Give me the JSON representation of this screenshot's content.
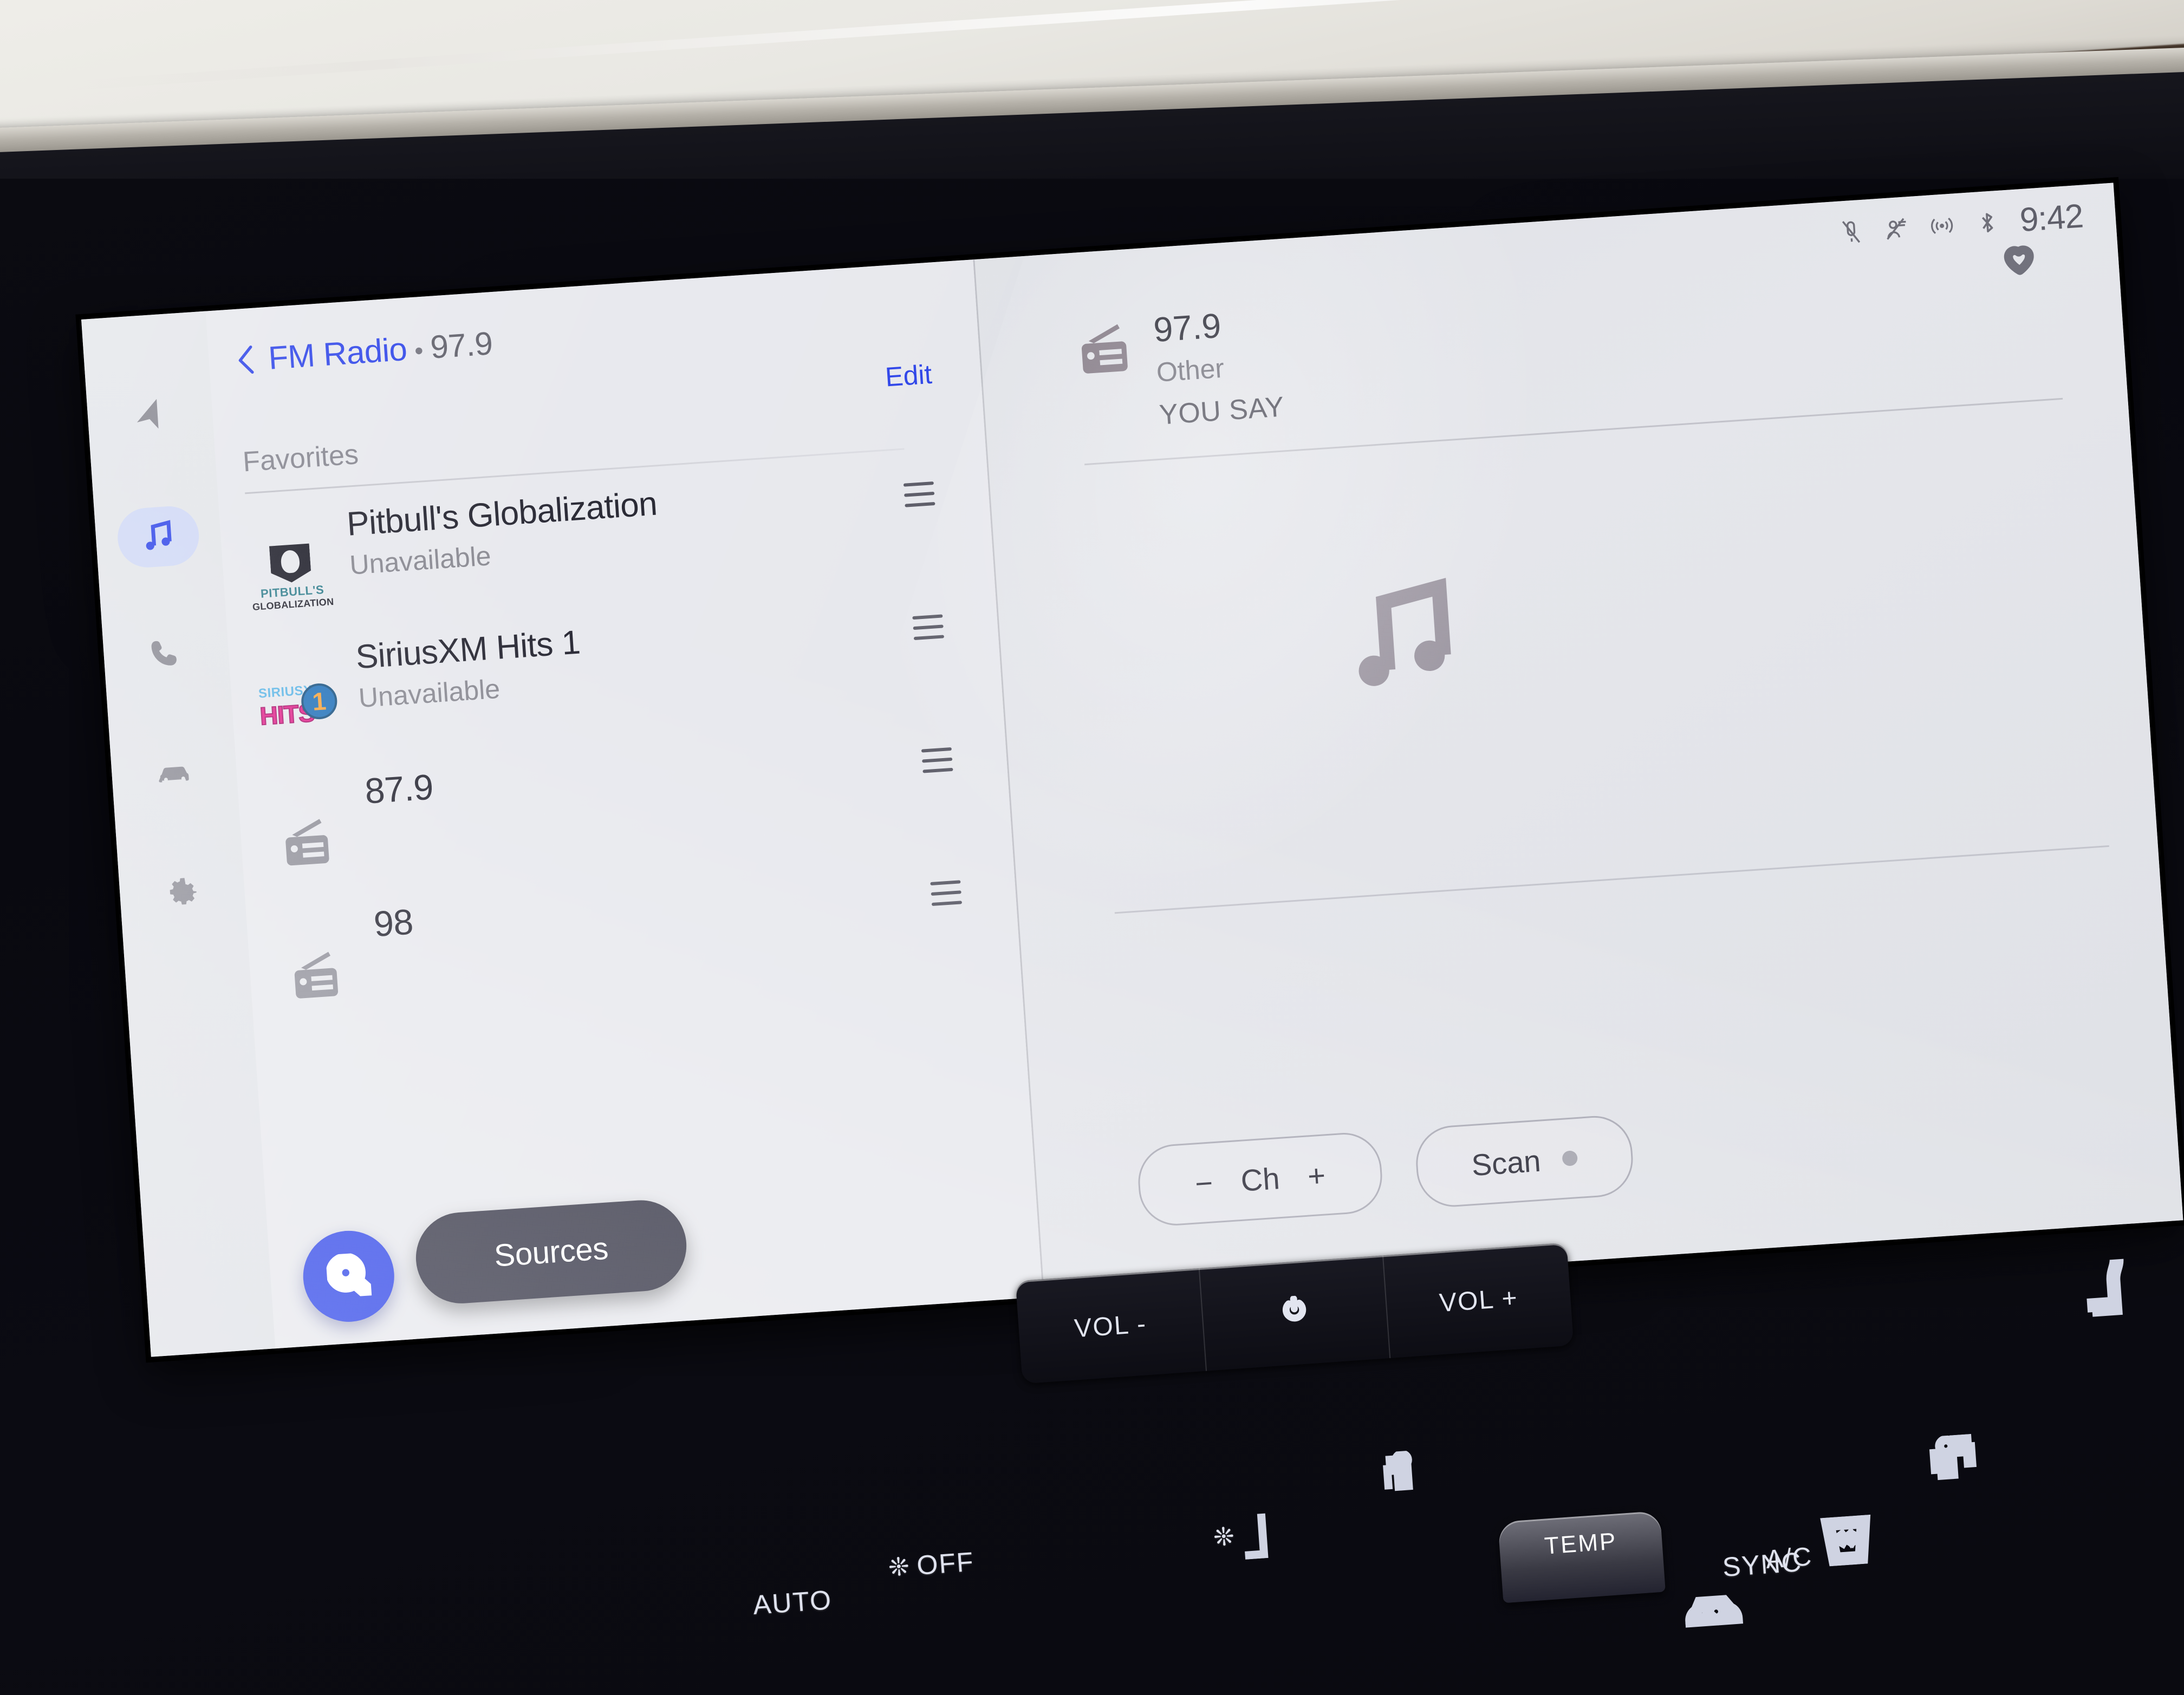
{
  "status_bar": {
    "icons": [
      "mic-mute-icon",
      "driver-attention-off-icon",
      "wireless-broadcast-icon",
      "bluetooth-icon"
    ],
    "clock": "9:42"
  },
  "sidebar": {
    "items": [
      {
        "name": "navigation",
        "icon": "navigation-arrow-icon",
        "active": false
      },
      {
        "name": "media",
        "icon": "music-note-icon",
        "active": true
      },
      {
        "name": "phone",
        "icon": "phone-icon",
        "active": false
      },
      {
        "name": "vehicle",
        "icon": "car-icon",
        "active": false
      },
      {
        "name": "settings",
        "icon": "gear-icon",
        "active": false
      }
    ]
  },
  "list_panel": {
    "back_icon": "chevron-left-icon",
    "title": "FM Radio",
    "separator": "•",
    "frequency": "97.9",
    "edit_label": "Edit",
    "section_label": "Favorites",
    "favorites": [
      {
        "logo": "pitbulls-globalization-logo",
        "name": "Pitbull's Globalization",
        "status": "Unavailable",
        "handle": "drag-handle-icon"
      },
      {
        "logo": "siriusxm-hits-1-logo",
        "name": "SiriusXM Hits 1",
        "status": "Unavailable",
        "handle": "drag-handle-icon"
      },
      {
        "logo": "radio-icon",
        "name": "87.9",
        "status": "",
        "handle": "drag-handle-icon"
      },
      {
        "logo": "radio-icon",
        "name": "98",
        "status": "",
        "handle": "drag-handle-icon"
      }
    ],
    "search_icon": "search-icon",
    "sources_label": "Sources"
  },
  "now_playing": {
    "favorite_icon": "heart-outline-icon",
    "source_icon": "radio-icon",
    "frequency": "97.9",
    "category": "Other",
    "song": "YOU SAY",
    "artwork_icon": "music-note-icon",
    "channel_minus": "−",
    "channel_label": "Ch",
    "channel_plus": "+",
    "scan_label": "Scan",
    "scan_indicator": "scan-status-dot"
  },
  "hardware_controls": {
    "buttons": [
      {
        "label": "VOL -",
        "icon": ""
      },
      {
        "label": "",
        "icon": "power-icon"
      },
      {
        "label": "VOL +",
        "icon": ""
      }
    ],
    "climate": [
      {
        "label": "AUTO",
        "icon": ""
      },
      {
        "label": "OFF",
        "icon": "fan-off-icon"
      },
      {
        "label": "",
        "icon": "fan-up-icon"
      },
      {
        "label": "",
        "icon": "seat-airflow-icon"
      },
      {
        "label": "",
        "icon": "recirculation-icon"
      },
      {
        "label": "A/C",
        "icon": ""
      },
      {
        "label": "",
        "icon": "front-defrost-icon"
      },
      {
        "label": "",
        "icon": "heated-steering-wheel-icon"
      },
      {
        "label": "SYNC",
        "icon": ""
      },
      {
        "label": "",
        "icon": "rear-defrost-icon"
      }
    ],
    "temp_knob_label": "TEMP"
  },
  "colors": {
    "accent_blue": "#2b42e8",
    "screen_bg": "#e9eaee",
    "panel_dark": "#303040"
  }
}
